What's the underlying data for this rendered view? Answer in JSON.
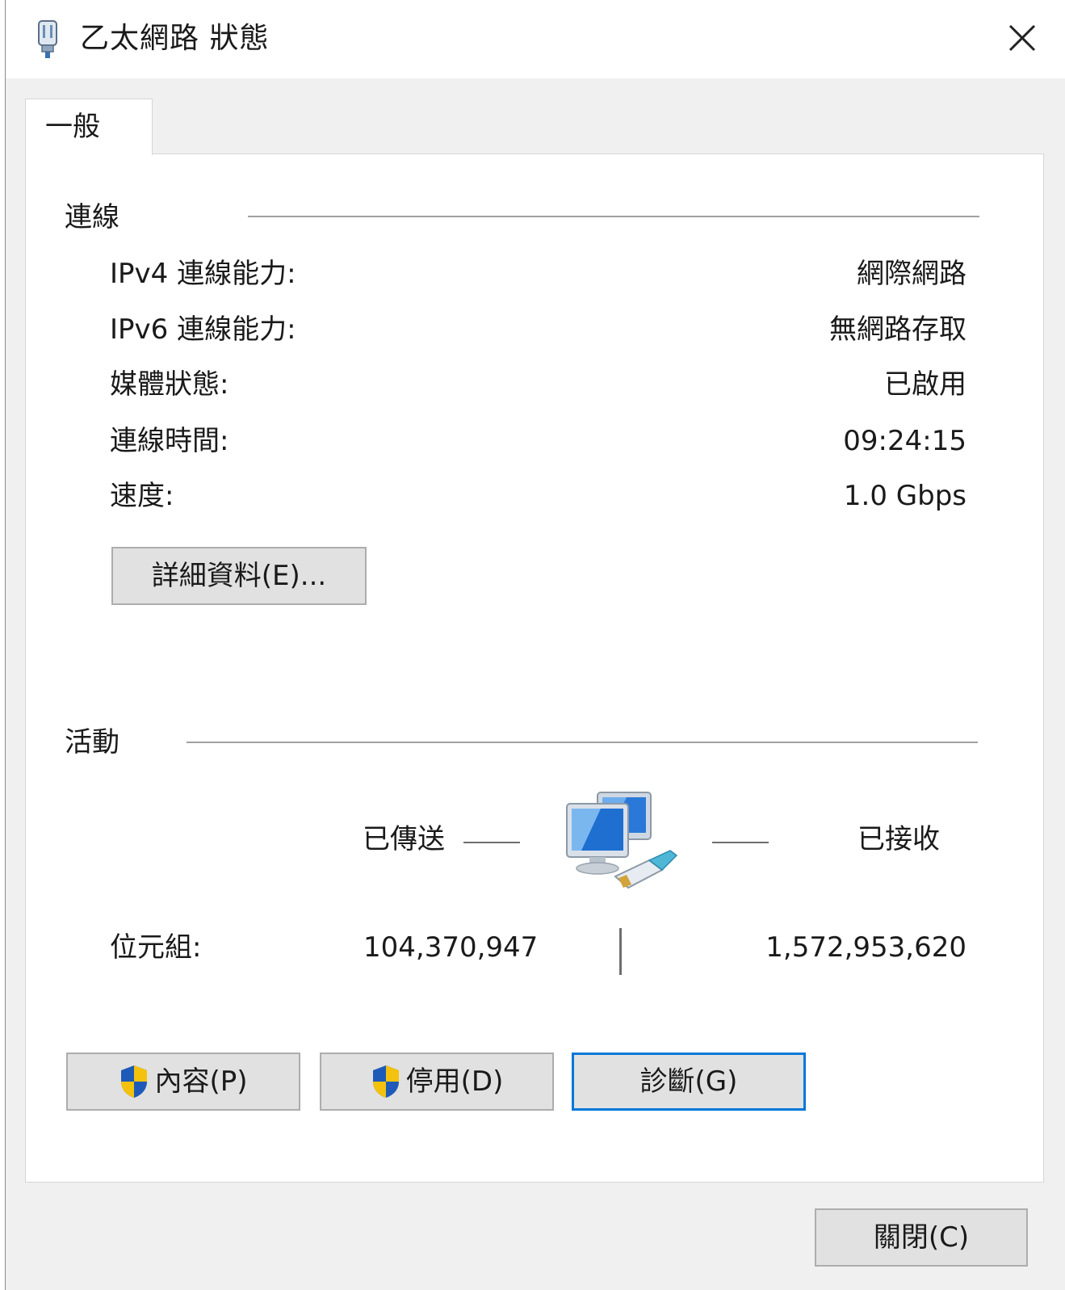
{
  "window": {
    "title": "乙太網路 狀態",
    "title_icon": "ethernet-adapter-icon",
    "close_icon": "close-icon"
  },
  "tabs": [
    {
      "label": "一般",
      "selected": true
    }
  ],
  "connection": {
    "section_title": "連線",
    "rows": [
      {
        "label": "IPv4 連線能力:",
        "value": "網際網路"
      },
      {
        "label": "IPv6 連線能力:",
        "value": "無網路存取"
      },
      {
        "label": "媒體狀態:",
        "value": "已啟用"
      },
      {
        "label": "連線時間:",
        "value": "09:24:15"
      },
      {
        "label": "速度:",
        "value": "1.0 Gbps"
      }
    ],
    "details_button": "詳細資料(E)..."
  },
  "activity": {
    "section_title": "活動",
    "sent_label": "已傳送",
    "received_label": "已接收",
    "network_icon": "network-computers-icon",
    "bytes_label": "位元組:",
    "bytes_sent": "104,370,947",
    "bytes_received": "1,572,953,620"
  },
  "buttons": {
    "properties": "內容(P)",
    "disable": "停用(D)",
    "diagnose": "診斷(G)",
    "close": "關閉(C)",
    "shield_icon": "uac-shield-icon"
  },
  "colors": {
    "focus_border": "#0078d7",
    "button_face": "#e1e1e1",
    "window_bg": "#f0f0f0"
  }
}
